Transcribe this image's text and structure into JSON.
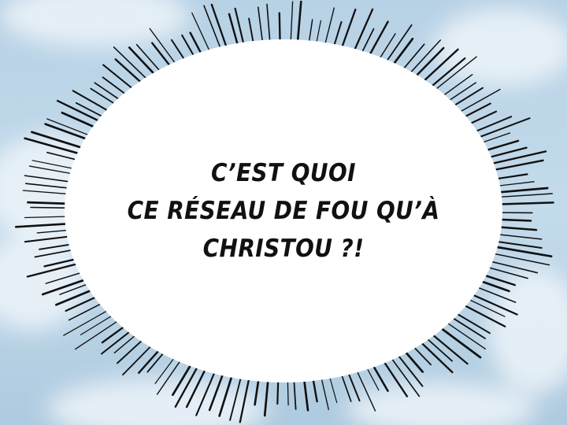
{
  "panel": {
    "lines": [
      "C’EST QUOI",
      "CE RÉSEAU DE FOU QU’À",
      "CHRISTOU ?!"
    ]
  },
  "colors": {
    "sky": "#b9d3e6",
    "cloud": "#e9f1f7",
    "bubble_fill": "#ffffff",
    "burst_lines": "#111111",
    "text": "#111111"
  }
}
